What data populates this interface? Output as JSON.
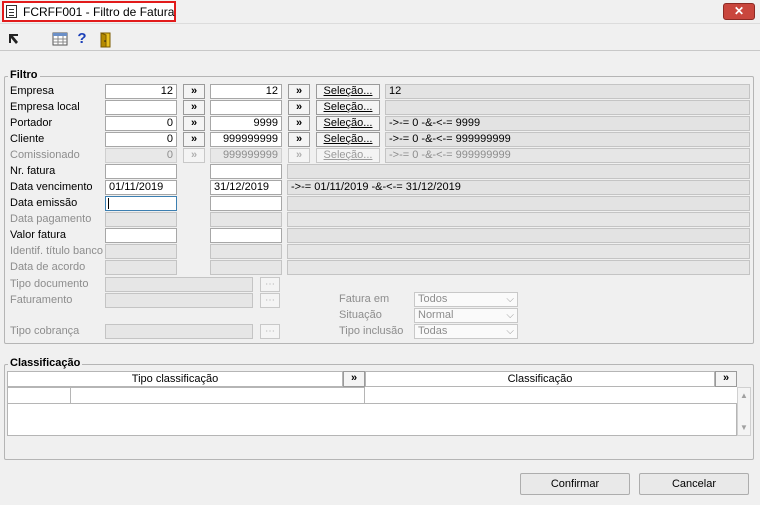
{
  "window": {
    "title": "FCRFF001 - Filtro de Fatura",
    "close_glyph": "✕"
  },
  "toolbar": {
    "icons": [
      "pointer-arrow-icon",
      "grid-icon",
      "help-icon",
      "exit-door-icon"
    ],
    "help_glyph": "?"
  },
  "filter": {
    "group_label": "Filtro",
    "selection_label": "Seleção...",
    "range_arrow": "»",
    "rows": {
      "empresa": {
        "label": "Empresa",
        "from": "12",
        "to": "12",
        "summary": "12"
      },
      "empresa_local": {
        "label": "Empresa local",
        "from": "",
        "to": "",
        "summary": ""
      },
      "portador": {
        "label": "Portador",
        "from": "0",
        "to": "9999",
        "summary": "->-= 0 -&-<-= 9999"
      },
      "cliente": {
        "label": "Cliente",
        "from": "0",
        "to": "999999999",
        "summary": "->-= 0 -&-<-= 999999999"
      },
      "comissionado": {
        "label": "Comissionado",
        "from": "0",
        "to": "999999999",
        "summary": "->-= 0 -&-<-= 999999999"
      },
      "nr_fatura": {
        "label": "Nr. fatura",
        "from": "",
        "to": "",
        "summary": ""
      },
      "data_vencimento": {
        "label": "Data vencimento",
        "from": "01/11/2019",
        "to": "31/12/2019",
        "summary": "->-= 01/11/2019 -&-<-= 31/12/2019"
      },
      "data_emissao": {
        "label": "Data emissão",
        "from": "",
        "to": "",
        "summary": ""
      },
      "data_pagamento": {
        "label": "Data pagamento"
      },
      "valor_fatura": {
        "label": "Valor fatura",
        "from": "",
        "to": "",
        "summary": ""
      },
      "identif_titulo_banco": {
        "label": "Identif. título banco"
      },
      "data_acordo": {
        "label": "Data de acordo"
      },
      "tipo_documento": {
        "label": "Tipo documento"
      },
      "faturamento": {
        "label": "Faturamento"
      },
      "tipo_cobranca": {
        "label": "Tipo cobrança"
      }
    },
    "combos": {
      "fatura_em": {
        "label": "Fatura em",
        "value": "Todos"
      },
      "situacao": {
        "label": "Situação",
        "value": "Normal"
      },
      "tipo_inclusao": {
        "label": "Tipo inclusão",
        "value": "Todas"
      }
    },
    "chevron_glyph": "⌵"
  },
  "classification": {
    "group_label": "Classificação",
    "columns": [
      "Tipo classificação",
      "Classificação"
    ]
  },
  "footer": {
    "confirm_label": "Confirmar",
    "cancel_label": "Cancelar"
  }
}
